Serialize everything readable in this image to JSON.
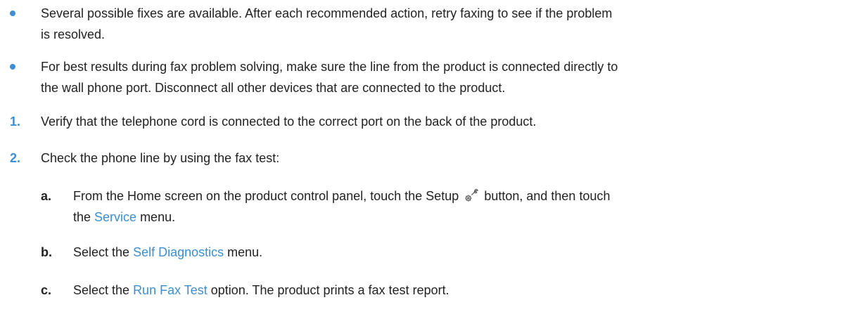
{
  "bullets": [
    {
      "lines": [
        "Several possible fixes are available. After each recommended action, retry faxing to see if the problem",
        "is resolved."
      ]
    },
    {
      "lines": [
        "For best results during fax problem solving, make sure the line from the product is connected directly to",
        "the wall phone port. Disconnect all other devices that are connected to the product."
      ]
    }
  ],
  "steps": [
    {
      "number": "1.",
      "text": "Verify that the telephone cord is connected to the correct port on the back of the product."
    },
    {
      "number": "2.",
      "text": "Check the phone line by using the fax test:"
    }
  ],
  "substeps": [
    {
      "letter": "a.",
      "line1_before": "From the Home screen on the product control panel, touch the Setup ",
      "icon": "wrench-gear-icon",
      "line1_after": " button, and then touch",
      "line2_before": "the ",
      "link": "Service",
      "line2_after": " menu."
    },
    {
      "letter": "b.",
      "before": "Select the ",
      "link": "Self Diagnostics",
      "after": " menu."
    },
    {
      "letter": "c.",
      "before": "Select the ",
      "link": "Run Fax Test",
      "after": " option. The product prints a fax test report."
    }
  ],
  "colors": {
    "accent": "#3c8fd2",
    "text": "#222222"
  }
}
